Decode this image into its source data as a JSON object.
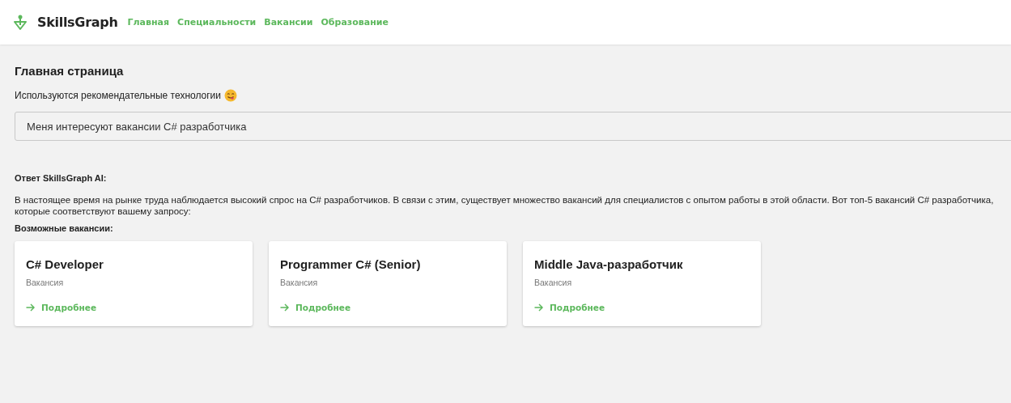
{
  "header": {
    "logo": "SkillsGraph",
    "nav": [
      {
        "label": "Главная"
      },
      {
        "label": "Специальности"
      },
      {
        "label": "Вакансии"
      },
      {
        "label": "Образование"
      }
    ]
  },
  "page": {
    "title": "Главная страница",
    "subtitle": "Используются рекомендательные технологии",
    "query": {
      "value": "Меня интересуют вакансии C# разработчика"
    },
    "answer_heading": "Ответ SkillsGraph AI:",
    "answer_text": "В настоящее время на рынке труда наблюдается высокий спрос на C# разработчиков. В связи с этим, существует множество вакансий для специалистов с опытом работы в этой области. Вот топ-5 вакансий C# разработчика, которые соответствуют вашему запросу:",
    "vacancies_heading": "Возможные вакансии:",
    "vacancies": [
      {
        "title": "C# Developer",
        "type": "Вакансия",
        "link": "Подробнее"
      },
      {
        "title": "Programmer C# (Senior)",
        "type": "Вакансия",
        "link": "Подробнее"
      },
      {
        "title": "Middle Java-разработчик",
        "type": "Вакансия",
        "link": "Подробнее"
      }
    ]
  }
}
